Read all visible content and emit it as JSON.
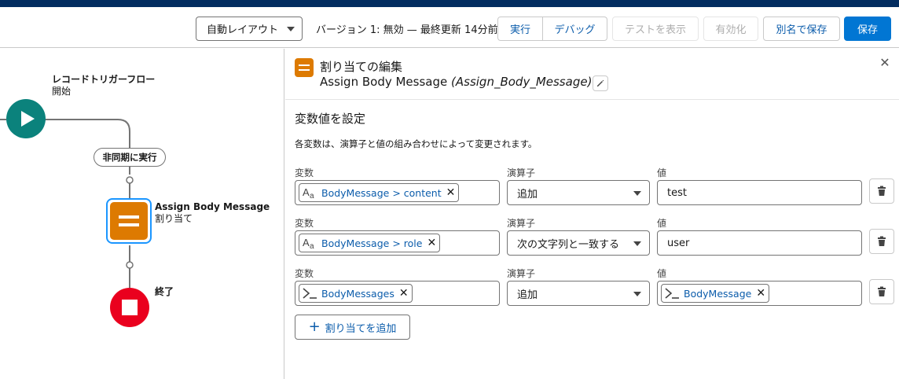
{
  "toolbar": {
    "layout_select": "自動レイアウト",
    "version_info": "バージョン 1: 無効 — 最終更新 14分前",
    "run_label": "実行",
    "debug_label": "デバッグ",
    "show_tests_label": "テストを表示",
    "activate_label": "有効化",
    "save_as_label": "別名で保存",
    "save_label": "保存"
  },
  "canvas": {
    "start_node": {
      "title": "レコードトリガーフロー",
      "subtitle": "開始"
    },
    "async_pill": "非同期に実行",
    "assign_node": {
      "title": "Assign Body Message",
      "subtitle": "割り当て"
    },
    "end_node": {
      "title": "終了"
    },
    "colors": {
      "start": "#0b827c",
      "assign": "#dd7a01",
      "end": "#ea001e"
    }
  },
  "panel": {
    "header_title": "割り当ての編集",
    "element_label": "Assign Body Message",
    "element_api": "(Assign_Body_Message)",
    "section_title": "変数値を設定",
    "section_desc": "各変数は、演算子と値の組み合わせによって変更されます。",
    "labels": {
      "variable": "変数",
      "operator": "演算子",
      "value": "値"
    },
    "rows": [
      {
        "variable": "BodyMessage > content",
        "variable_icon": "text-icon",
        "operator": "追加",
        "value": "test",
        "value_is_pill": false
      },
      {
        "variable": "BodyMessage > role",
        "variable_icon": "text-icon",
        "operator": "次の文字列と一致する",
        "value": "user",
        "value_is_pill": false
      },
      {
        "variable": "BodyMessages",
        "variable_icon": "apex-icon",
        "operator": "追加",
        "value": "BodyMessage",
        "value_is_pill": true,
        "value_icon": "apex-icon"
      }
    ],
    "add_assignment_label": "割り当てを追加"
  }
}
